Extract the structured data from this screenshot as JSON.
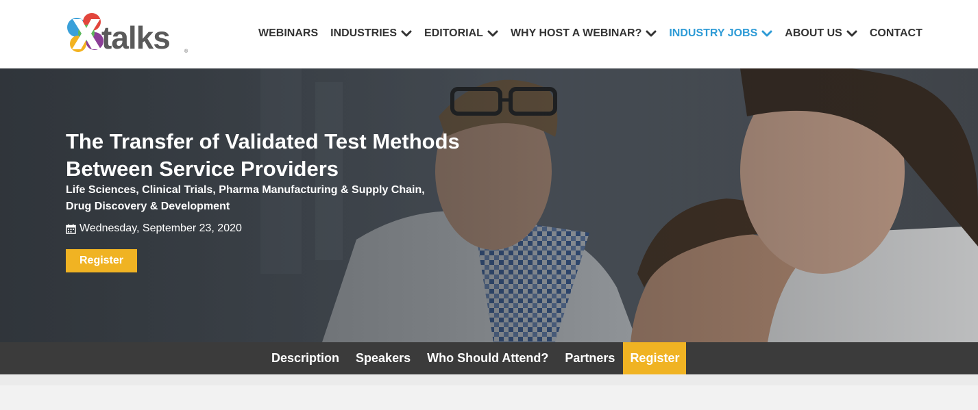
{
  "brand": {
    "name": "Xtalks",
    "logo_letter": "X",
    "logo_text": "talks",
    "colors": {
      "accent_blue": "#2e9bd6",
      "register_yellow": "#f0b323",
      "subnav_bg": "#3b3b3b",
      "nav_text": "#333333"
    }
  },
  "nav": {
    "items": [
      {
        "label": "WEBINARS",
        "has_dropdown": false,
        "active": false
      },
      {
        "label": "INDUSTRIES",
        "has_dropdown": true,
        "active": false
      },
      {
        "label": "EDITORIAL",
        "has_dropdown": true,
        "active": false
      },
      {
        "label": "WHY HOST A WEBINAR?",
        "has_dropdown": true,
        "active": false
      },
      {
        "label": "INDUSTRY JOBS",
        "has_dropdown": true,
        "active": true
      },
      {
        "label": "ABOUT US",
        "has_dropdown": true,
        "active": false
      },
      {
        "label": "CONTACT",
        "has_dropdown": false,
        "active": false
      }
    ],
    "dropdown_icon": "chevron-down-icon"
  },
  "hero": {
    "title": "The Transfer of Validated Test Methods Between Service Providers",
    "categories": "Life Sciences, Clinical Trials, Pharma Manufacturing & Supply Chain, Drug Discovery & Development",
    "date_icon": "calendar-icon",
    "date": "Wednesday, September 23, 2020",
    "register_label": "Register"
  },
  "subnav": {
    "items": [
      {
        "label": "Description",
        "highlight": false
      },
      {
        "label": "Speakers",
        "highlight": false
      },
      {
        "label": "Who Should Attend?",
        "highlight": false
      },
      {
        "label": "Partners",
        "highlight": false
      },
      {
        "label": "Register",
        "highlight": true
      }
    ]
  }
}
